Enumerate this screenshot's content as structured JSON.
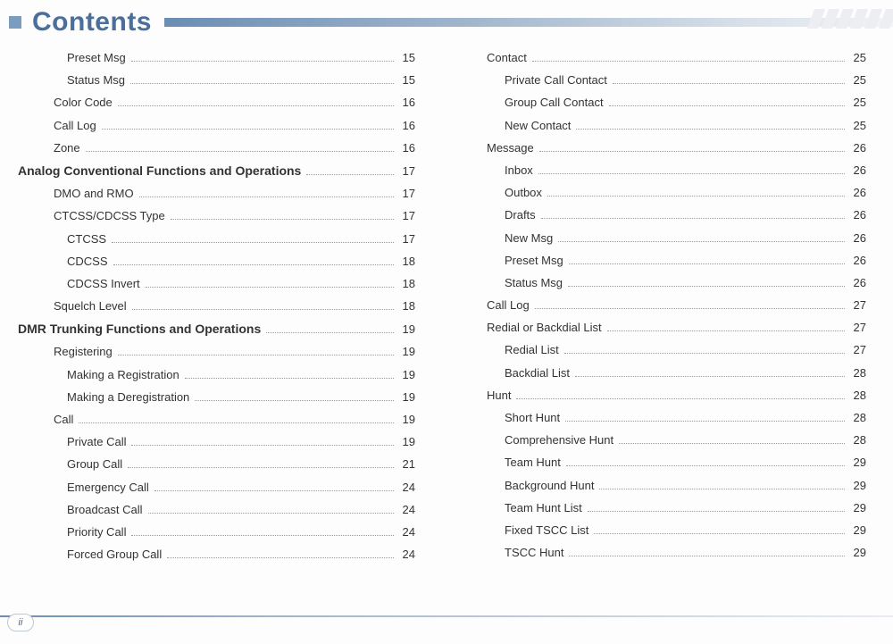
{
  "header": {
    "title": "Contents"
  },
  "footer": {
    "pageLabel": "ii"
  },
  "leftColumn": [
    {
      "label": "Preset Msg",
      "page": "15",
      "level": 3
    },
    {
      "label": "Status Msg",
      "page": "15",
      "level": 3
    },
    {
      "label": "Color Code",
      "page": "16",
      "level": 2
    },
    {
      "label": "Call Log",
      "page": "16",
      "level": 2
    },
    {
      "label": "Zone",
      "page": "16",
      "level": 2
    },
    {
      "label": "Analog Conventional Functions and Operations",
      "page": "17",
      "level": 0
    },
    {
      "label": "DMO and RMO",
      "page": "17",
      "level": 2
    },
    {
      "label": "CTCSS/CDCSS Type",
      "page": "17",
      "level": 2
    },
    {
      "label": "CTCSS",
      "page": "17",
      "level": 3
    },
    {
      "label": "CDCSS",
      "page": "18",
      "level": 3
    },
    {
      "label": "CDCSS Invert",
      "page": "18",
      "level": 3
    },
    {
      "label": "Squelch Level",
      "page": "18",
      "level": 2
    },
    {
      "label": "DMR Trunking Functions and Operations",
      "page": "19",
      "level": 0
    },
    {
      "label": "Registering",
      "page": "19",
      "level": 2
    },
    {
      "label": "Making a Registration",
      "page": "19",
      "level": 3
    },
    {
      "label": "Making a Deregistration",
      "page": "19",
      "level": 3
    },
    {
      "label": "Call",
      "page": "19",
      "level": 2
    },
    {
      "label": "Private Call",
      "page": "19",
      "level": 3
    },
    {
      "label": "Group Call",
      "page": "21",
      "level": 3
    },
    {
      "label": "Emergency Call",
      "page": "24",
      "level": 3
    },
    {
      "label": "Broadcast Call",
      "page": "24",
      "level": 3
    },
    {
      "label": "Priority Call",
      "page": "24",
      "level": 3
    },
    {
      "label": "Forced Group Call",
      "page": "24",
      "level": 3
    }
  ],
  "rightColumn": [
    {
      "label": "Contact",
      "page": "25",
      "level": 1
    },
    {
      "label": "Private Call Contact",
      "page": "25",
      "level": 2
    },
    {
      "label": "Group Call Contact",
      "page": "25",
      "level": 2
    },
    {
      "label": "New Contact",
      "page": "25",
      "level": 2
    },
    {
      "label": "Message",
      "page": "26",
      "level": 1
    },
    {
      "label": "Inbox",
      "page": "26",
      "level": 2
    },
    {
      "label": "Outbox",
      "page": "26",
      "level": 2
    },
    {
      "label": "Drafts",
      "page": "26",
      "level": 2
    },
    {
      "label": "New Msg",
      "page": "26",
      "level": 2
    },
    {
      "label": "Preset Msg",
      "page": "26",
      "level": 2
    },
    {
      "label": "Status Msg",
      "page": "26",
      "level": 2
    },
    {
      "label": "Call Log",
      "page": "27",
      "level": 1
    },
    {
      "label": "Redial or Backdial List",
      "page": "27",
      "level": 1
    },
    {
      "label": "Redial List",
      "page": "27",
      "level": 2
    },
    {
      "label": "Backdial List",
      "page": "28",
      "level": 2
    },
    {
      "label": "Hunt",
      "page": "28",
      "level": 1
    },
    {
      "label": "Short Hunt",
      "page": "28",
      "level": 2
    },
    {
      "label": "Comprehensive Hunt",
      "page": "28",
      "level": 2
    },
    {
      "label": "Team Hunt",
      "page": "29",
      "level": 2
    },
    {
      "label": "Background Hunt",
      "page": "29",
      "level": 2
    },
    {
      "label": "Team Hunt List",
      "page": "29",
      "level": 2
    },
    {
      "label": "Fixed TSCC List",
      "page": "29",
      "level": 2
    },
    {
      "label": "TSCC Hunt",
      "page": "29",
      "level": 2
    }
  ]
}
